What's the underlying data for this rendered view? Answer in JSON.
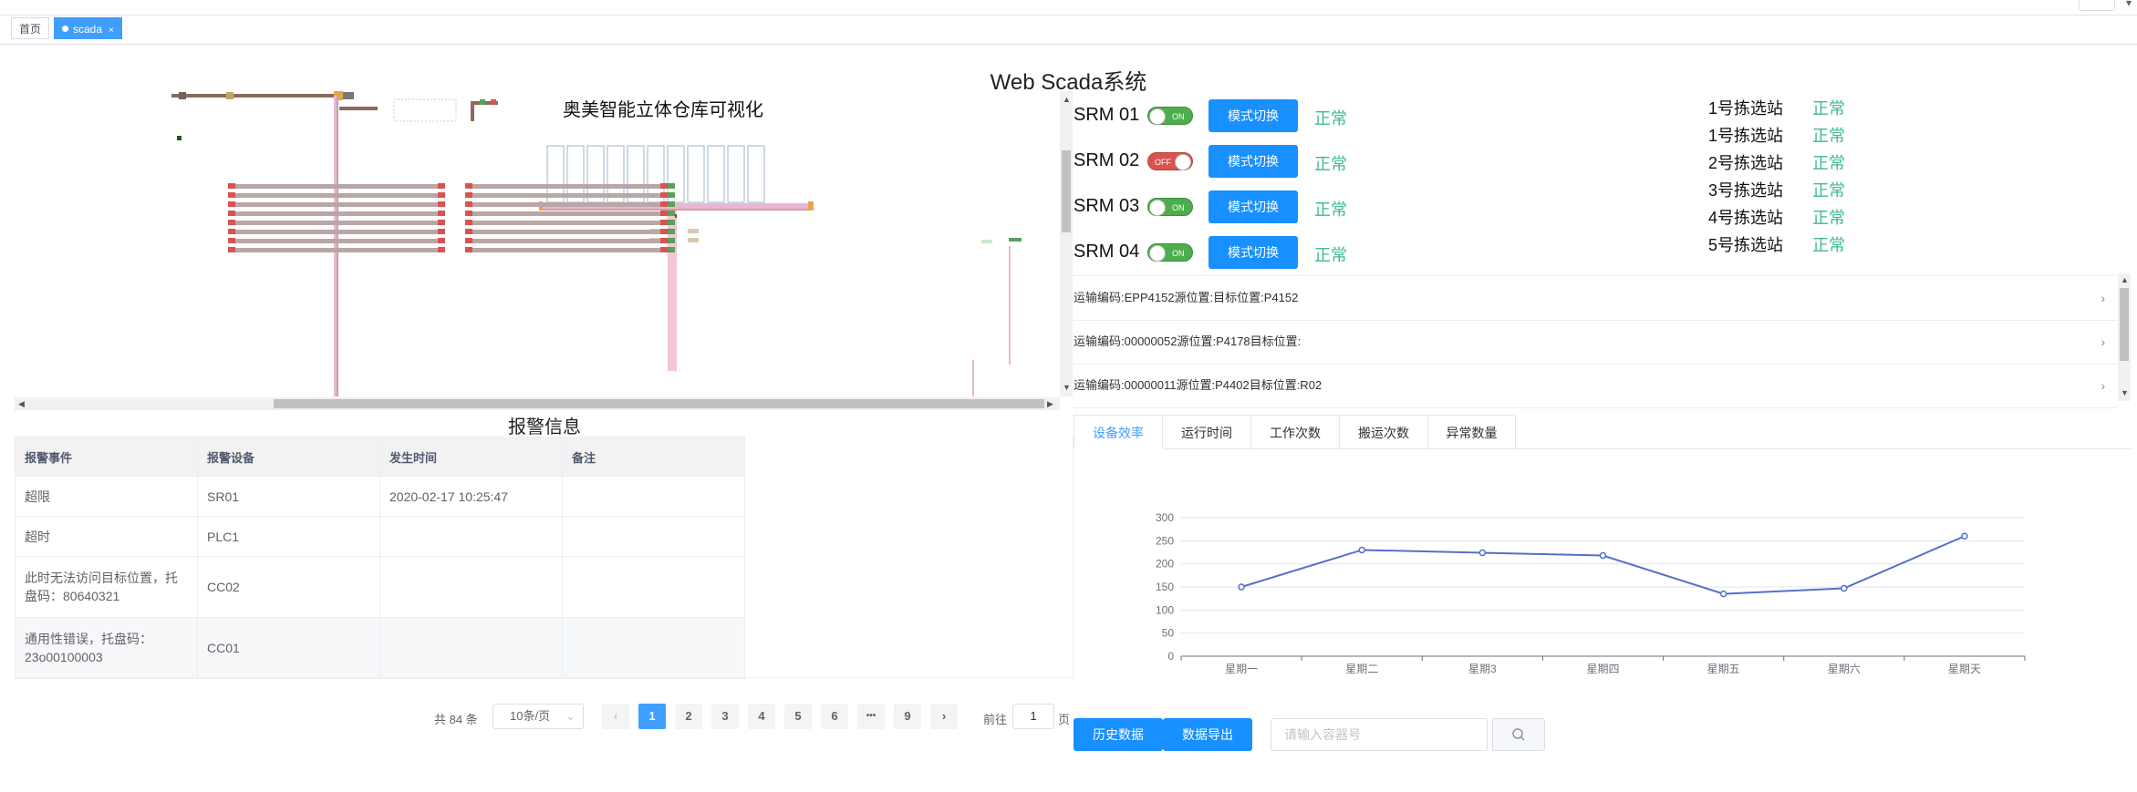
{
  "tabs": [
    {
      "label": "首页"
    },
    {
      "label": "scada",
      "close": "×"
    }
  ],
  "page_title": "Web Scada系统",
  "warehouse": {
    "title": "奥美智能立体仓库可视化"
  },
  "alarm": {
    "title": "报警信息",
    "columns": [
      "报警事件",
      "报警设备",
      "发生时间",
      "备注"
    ],
    "rows": [
      {
        "event": "超限",
        "device": "SR01",
        "time": "2020-02-17 10:25:47",
        "note": ""
      },
      {
        "event": "超时",
        "device": "PLC1",
        "time": "",
        "note": ""
      },
      {
        "event": "此时无法访问目标位置，托盘码：80640321",
        "device": "CC02",
        "time": "",
        "note": ""
      },
      {
        "event": "通用性错误，托盘码：23o00100003",
        "device": "CC01",
        "time": "",
        "note": ""
      }
    ]
  },
  "pagination": {
    "total": "共 84 条",
    "page_size": "10条/页",
    "pages": [
      "1",
      "2",
      "3",
      "4",
      "5",
      "6",
      "•••",
      "9"
    ],
    "current": "1",
    "goto_prefix": "前往",
    "goto_value": "1",
    "goto_suffix": "页",
    "prev": "‹",
    "next": "›"
  },
  "srm": [
    {
      "label": "SRM 01",
      "state": "ON",
      "button": "模式切换",
      "status": "正常"
    },
    {
      "label": "SRM 02",
      "state": "OFF",
      "button": "模式切换",
      "status": "正常"
    },
    {
      "label": "SRM 03",
      "state": "ON",
      "button": "模式切换",
      "status": "正常"
    },
    {
      "label": "SRM 04",
      "state": "ON",
      "button": "模式切换",
      "status": "正常"
    }
  ],
  "stations": [
    {
      "name": "1号拣选站",
      "status": "正常"
    },
    {
      "name": "1号拣选站",
      "status": "正常"
    },
    {
      "name": "2号拣选站",
      "status": "正常"
    },
    {
      "name": "3号拣选站",
      "status": "正常"
    },
    {
      "name": "4号拣选站",
      "status": "正常"
    },
    {
      "name": "5号拣选站",
      "status": "正常"
    }
  ],
  "transports": [
    {
      "text": "运输编码:EPP4152源位置:目标位置:P4152"
    },
    {
      "text": "运输编码:00000052源位置:P4178目标位置:"
    },
    {
      "text": "运输编码:00000011源位置:P4402目标位置:R02"
    }
  ],
  "chart_tabs": [
    "设备效率",
    "运行时间",
    "工作次数",
    "搬运次数",
    "异常数量"
  ],
  "chart_data": {
    "type": "line",
    "categories": [
      "星期一",
      "星期二",
      "星期3",
      "星期四",
      "星期五",
      "星期六",
      "星期天"
    ],
    "series": [
      {
        "values": [
          150,
          230,
          224,
          218,
          135,
          147,
          260
        ]
      }
    ],
    "yticks": [
      "0",
      "50",
      "100",
      "150",
      "200",
      "250",
      "300"
    ],
    "ylim": [
      0,
      300
    ],
    "line_color": "#5470c6"
  },
  "actions": {
    "history": "历史数据",
    "export": "数据导出",
    "search_placeholder": "请输入容器号"
  },
  "colors": {
    "primary": "#1890ff",
    "ok": "#3dbb8a"
  }
}
